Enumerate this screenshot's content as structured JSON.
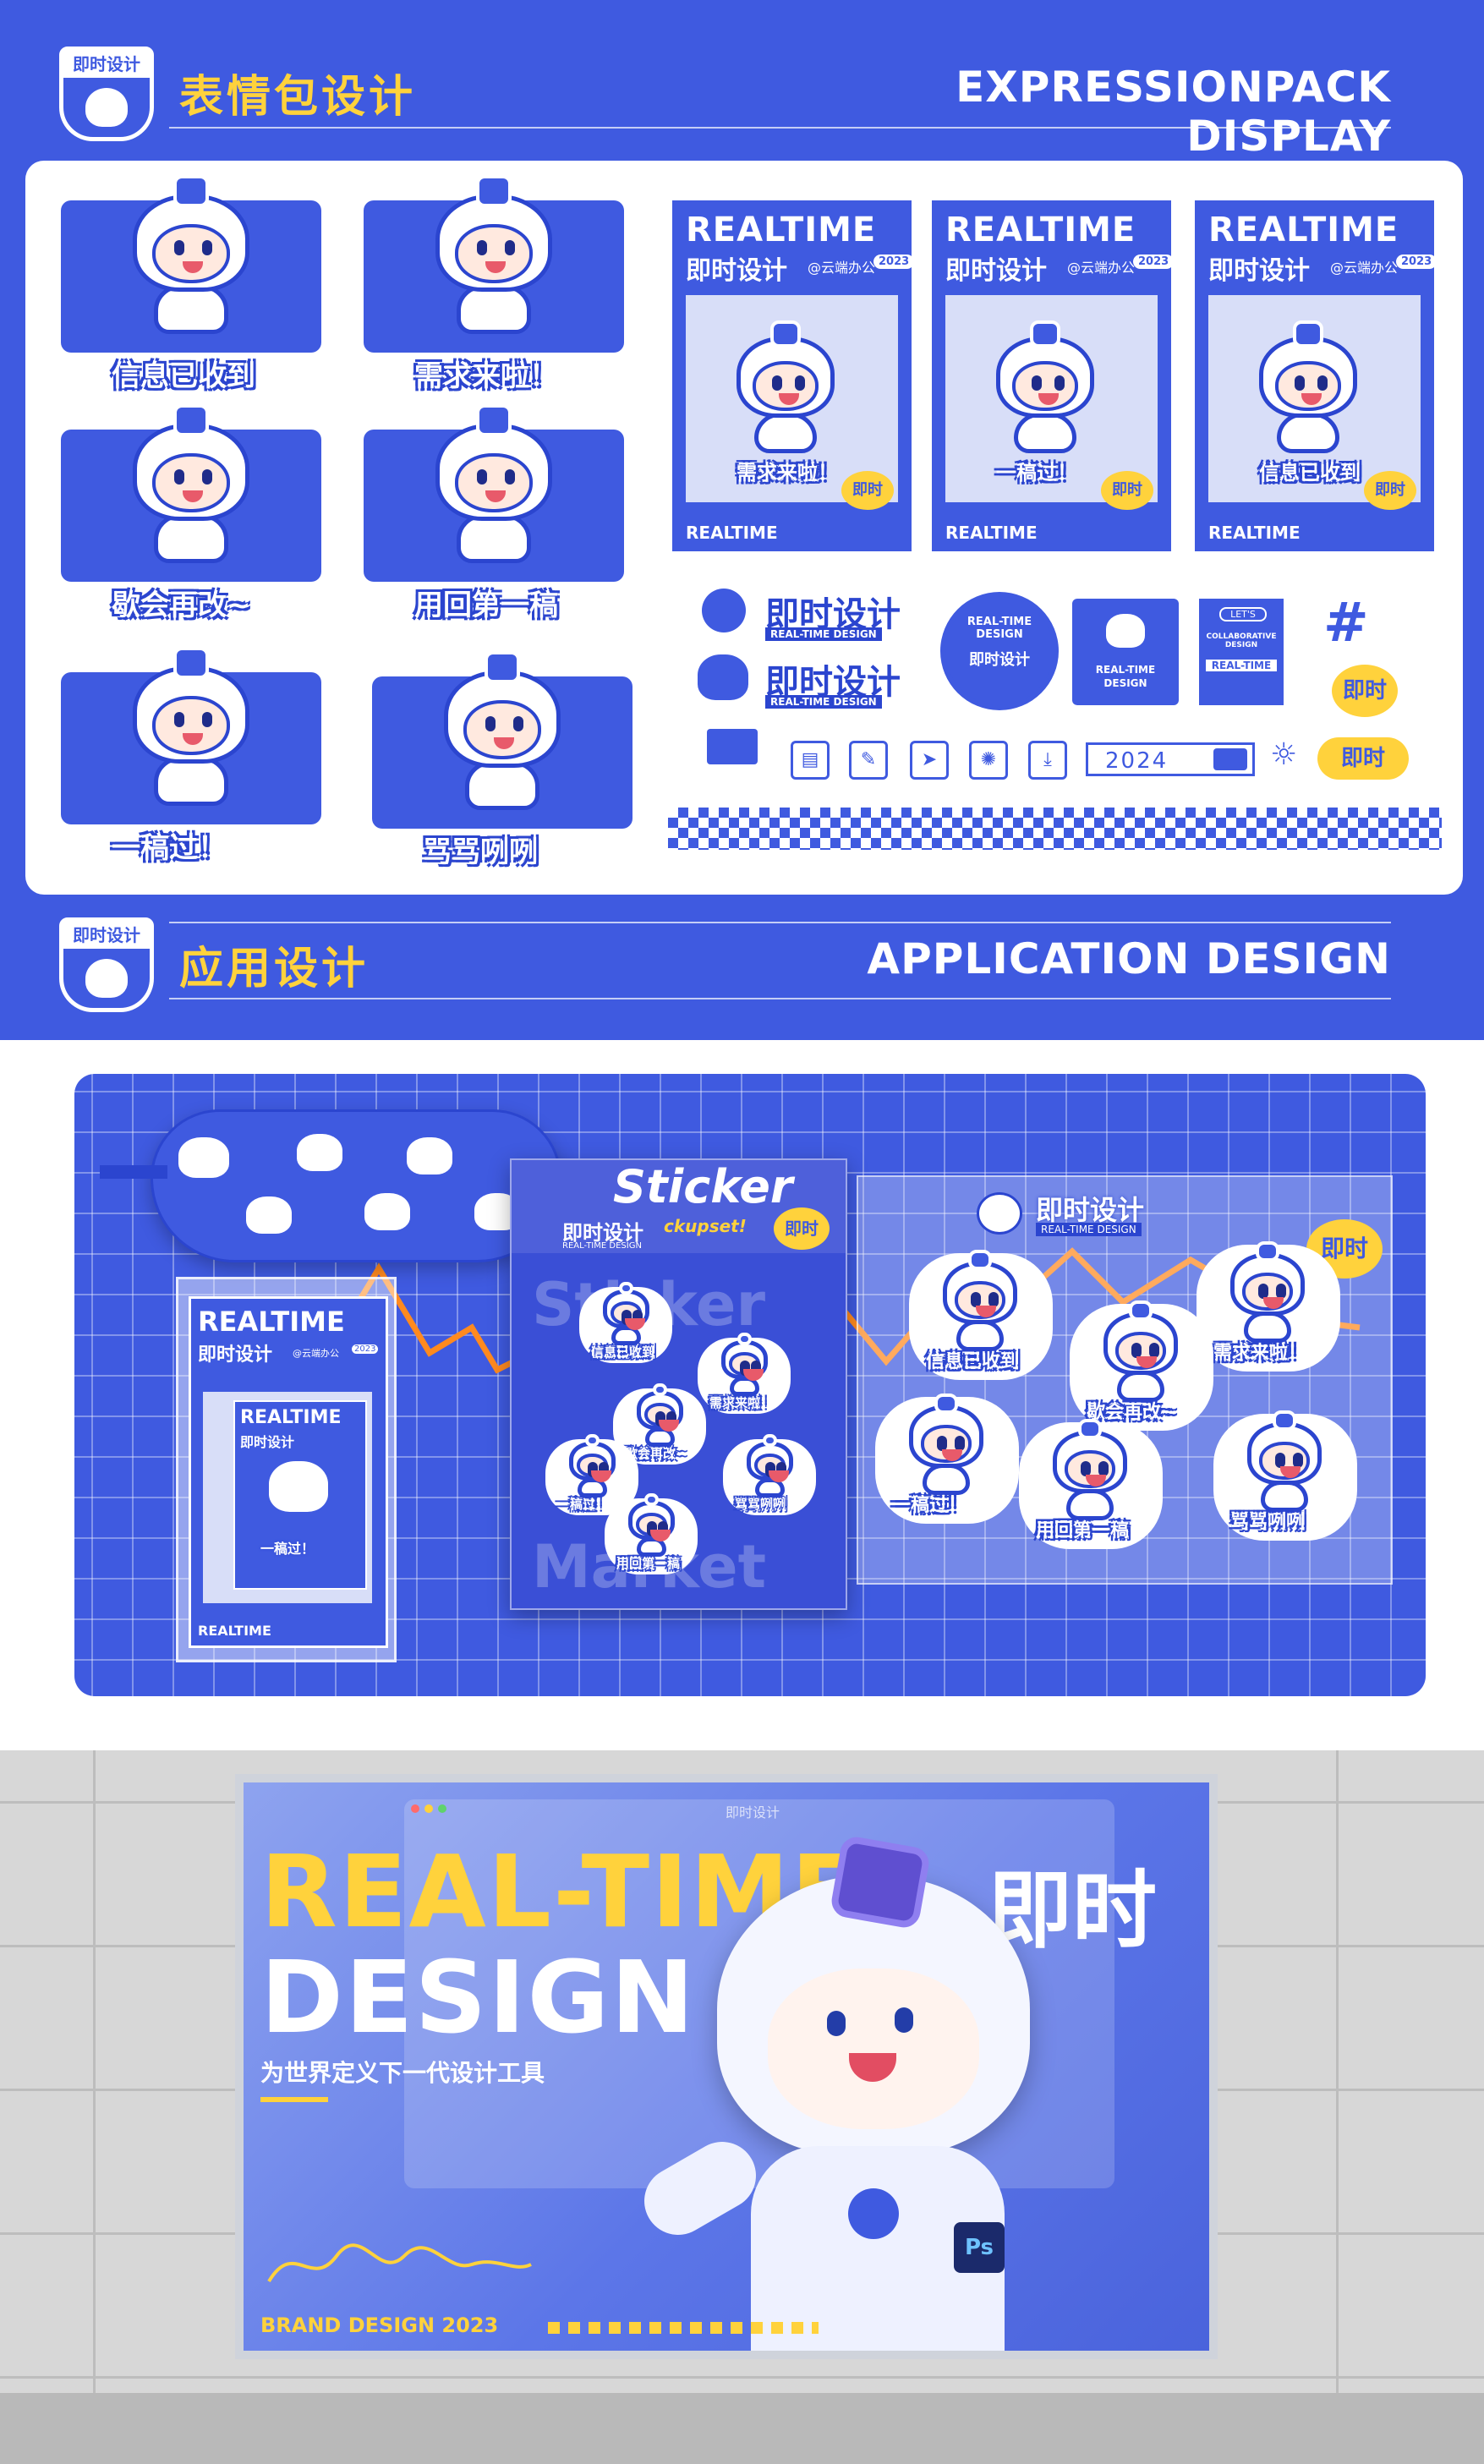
{
  "colors": {
    "brand_blue": "#3f5ae0",
    "accent_yellow": "#ffd23c",
    "white": "#ffffff"
  },
  "section1": {
    "badge_label": "即时设计",
    "title_cn": "表情包设计",
    "title_en": "EXPRESSIONPACK DISPLAY"
  },
  "stickers": [
    {
      "caption": "信息已收到"
    },
    {
      "caption": "需求来啦！"
    },
    {
      "caption": "歇会再改~"
    },
    {
      "caption": "用回第一稿"
    },
    {
      "caption": "一稿过！"
    },
    {
      "caption": "骂骂咧咧"
    }
  ],
  "posters": [
    {
      "title": "REALTIME",
      "cn": "即时设计",
      "sub": "@云端办公",
      "year": "2023",
      "caption": "需求来啦！",
      "burst": "即时",
      "foot": "REALTIME"
    },
    {
      "title": "REALTIME",
      "cn": "即时设计",
      "sub": "@云端办公",
      "year": "2023",
      "caption": "一稿过！",
      "burst": "即时",
      "foot": "REALTIME"
    },
    {
      "title": "REALTIME",
      "cn": "即时设计",
      "sub": "@云端办公",
      "year": "2023",
      "caption": "信息已收到",
      "burst": "即时",
      "foot": "REALTIME"
    }
  ],
  "brand_kit": {
    "logo_cn": "即时设计",
    "logo_en": "REAL-TIME DESIGN",
    "seal_text": "REAL-TIME DESIGN",
    "seal_cn": "即时设计",
    "square_label": "REAL-TIME DESIGN",
    "tag_top": "LET'S",
    "tag_mid": "COLLABORATIVE DESIGN",
    "tag_bottom": "REAL-TIME",
    "burst1": "即时",
    "burst2": "即时",
    "year_box": "2024"
  },
  "section2": {
    "badge_label": "即时设计",
    "title_cn": "应用设计",
    "title_en": "APPLICATION DESIGN"
  },
  "mockups": {
    "sticker_bag_title": "Sticker",
    "sticker_bag_cn": "即时设计",
    "sticker_bag_en": "REAL-TIME DESIGN",
    "sticker_bag_tag": "ckupset!",
    "sticker_bag_burst": "即时",
    "sticker_bag_bg_words": [
      "Sticker",
      "Market"
    ],
    "notebook_title": "REALTIME",
    "notebook_cn": "即时设计",
    "notebook_sub": "@云端办公",
    "notebook_year": "2023",
    "notebook_inner_title": "REALTIME",
    "notebook_inner_cn": "即时设计",
    "notebook_caption": "一稿过！",
    "notebook_foot": "REALTIME",
    "sheet_logo_cn": "即时设计",
    "sheet_logo_en": "REAL-TIME DESIGN",
    "sheet_burst": "即时",
    "sheet_captions": [
      "信息已收到",
      "需求来啦！",
      "歇会再改~",
      "一稿过！",
      "用回第一稿",
      "骂骂咧咧"
    ],
    "bag_captions": [
      "信息已收到",
      "需求来啦！",
      "歇会再改~",
      "一稿过！",
      "用回第一稿",
      "骂骂咧咧"
    ]
  },
  "billboard": {
    "window_title": "即时设计",
    "line1": "REAL-TIME",
    "line2": "DESIGN",
    "cn": "即时",
    "tagline": "为世界定义下一代设计工具",
    "brand": "BRAND DESIGN 2023"
  }
}
